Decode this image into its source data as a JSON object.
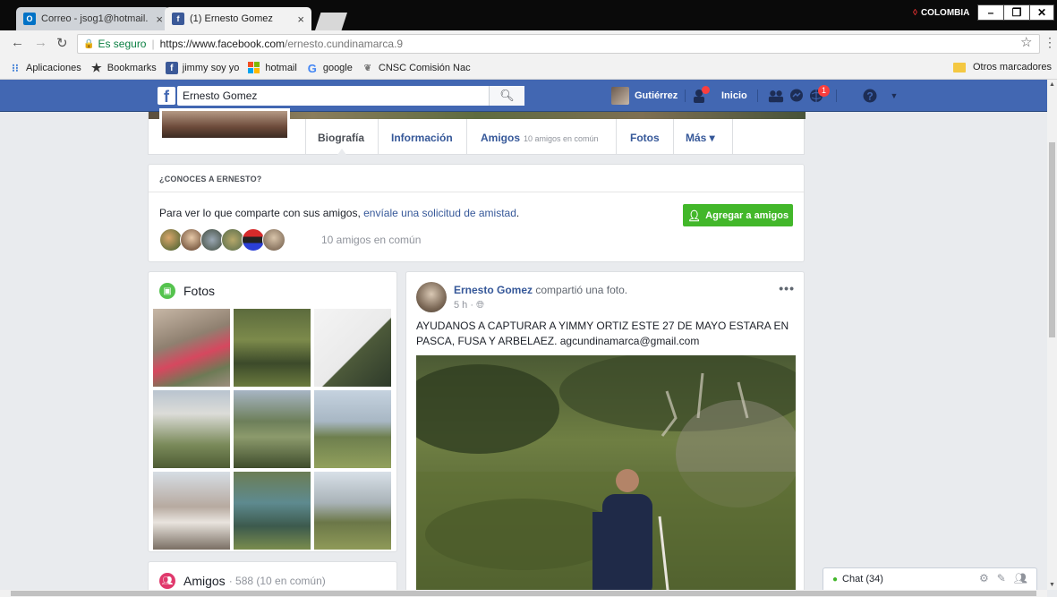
{
  "browser": {
    "tabs": [
      {
        "title": "Correo - jsog1@hotmail.",
        "icon": "outlook-icon",
        "active": false
      },
      {
        "title": "(1) Ernesto Gomez",
        "icon": "facebook-icon",
        "active": true
      }
    ],
    "region_label": "COLOMBIA",
    "window_buttons": [
      "–",
      "❐",
      "✕"
    ],
    "address": {
      "secure_label": "Es seguro",
      "host": "https://www.facebook.com",
      "path": "/ernesto.cundinamarca.9"
    },
    "bookmarks": [
      {
        "label": "Aplicaciones",
        "icon": "apps-grid-icon"
      },
      {
        "label": "Bookmarks",
        "icon": "star-icon"
      },
      {
        "label": "jimmy soy yo",
        "icon": "facebook-icon"
      },
      {
        "label": "hotmail",
        "icon": "windows-icon"
      },
      {
        "label": "google",
        "icon": "google-icon"
      },
      {
        "label": "CNSC Comisión Nac",
        "icon": "cnsc-icon"
      }
    ],
    "other_bookmarks": "Otros marcadores"
  },
  "fb_header": {
    "search_value": "Ernesto Gomez",
    "user_name": "Gutiérrez",
    "home_label": "Inicio",
    "notification_count": "1"
  },
  "profile_nav": {
    "items": [
      "Biografía",
      "Información",
      "Amigos",
      "Fotos",
      "Más ▾"
    ],
    "amigos_sub": "10 amigos en común"
  },
  "know_card": {
    "heading": "¿CONOCES A ERNESTO?",
    "message_prefix": "Para ver lo que comparte con sus amigos, ",
    "message_link": "envíale una solicitud de amistad",
    "message_suffix": ".",
    "add_button": "Agregar a amigos",
    "mutual": "10 amigos en común"
  },
  "photos": {
    "title": "Fotos"
  },
  "friends": {
    "title": "Amigos",
    "count": "· 588 (10 en común)"
  },
  "post": {
    "author": "Ernesto Gomez",
    "action": " compartió una foto.",
    "time": "5 h · ",
    "text": "AYUDANOS A CAPTURAR A YIMMY ORTIZ ESTE 27 DE MAYO ESTARA EN PASCA, FUSA Y ARBELAEZ. agcundinamarca@gmail.com",
    "more": "•••"
  },
  "chat": {
    "label": "Chat (34)"
  },
  "colors": {
    "fb_blue": "#4267b2",
    "link": "#365899",
    "green": "#42b72a"
  }
}
